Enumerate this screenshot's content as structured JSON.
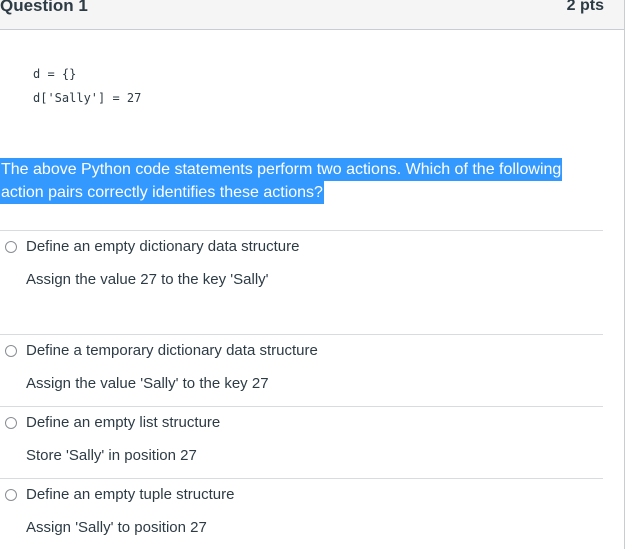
{
  "question": {
    "title": "Question 1",
    "points": "2 pts",
    "code_lines": [
      "d = {}",
      "d['Sally'] = 27"
    ],
    "prompt_lines": [
      "The above Python code statements perform two actions. Which of the following",
      "action pairs correctly identifies these actions?"
    ]
  },
  "answers": [
    {
      "line1": "Define an empty dictionary data structure",
      "line2": "Assign the value 27 to the key 'Sally'",
      "selected": false
    },
    {
      "line1": "Define a temporary dictionary data structure",
      "line2": "Assign the value 'Sally' to the key 27",
      "selected": false
    },
    {
      "line1": "Define an empty list structure",
      "line2": "Store 'Sally' in position 27",
      "selected": false
    },
    {
      "line1": "Define an empty tuple structure",
      "line2": "Assign 'Sally' to position 27",
      "selected": false
    }
  ],
  "colors": {
    "text": "#2d3b45",
    "selection_highlight": "#3399ff",
    "header_bg": "#f5f5f5",
    "border": "#c7cdd1"
  }
}
